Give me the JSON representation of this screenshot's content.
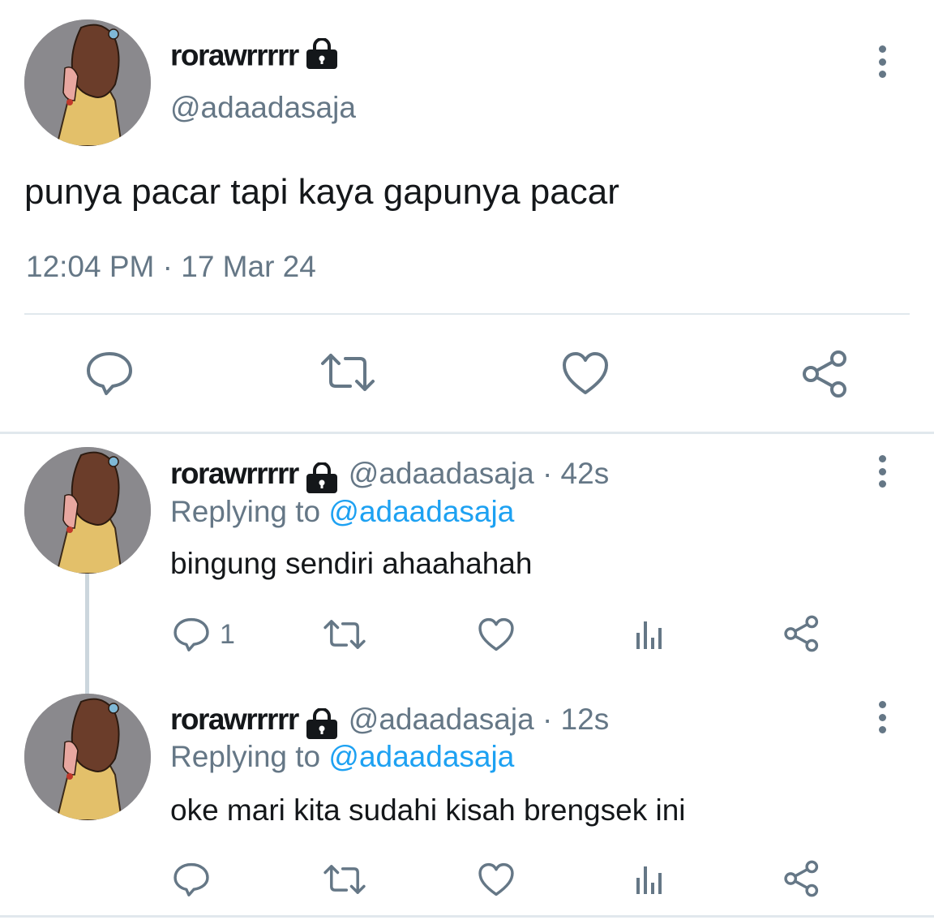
{
  "main_tweet": {
    "display_name": "rorawrrrrr",
    "handle": "@adaadasaja",
    "text": "punya pacar tapi kaya gapunya pacar",
    "timestamp": "12:04 PM · 17 Mar 24"
  },
  "replies": [
    {
      "display_name": "rorawrrrrr",
      "handle_time": "@adaadasaja · 42s",
      "replying_prefix": "Replying to",
      "replying_handle": "@adaadasaja",
      "text": "bingung sendiri ahaahahah",
      "reply_count": "1"
    },
    {
      "display_name": "rorawrrrrr",
      "handle_time": "@adaadasaja · 12s",
      "replying_prefix": "Replying to",
      "replying_handle": "@adaadasaja",
      "text": "oke mari kita sudahi kisah brengsek ini",
      "reply_count": ""
    }
  ],
  "icons": {
    "reply": "comment-icon",
    "retweet": "retweet-icon",
    "like": "heart-icon",
    "analytics": "analytics-icon",
    "share": "share-icon",
    "lock": "lock-icon",
    "more": "more-vertical-icon"
  },
  "colors": {
    "text": "#14171a",
    "secondary": "#657786",
    "link": "#1da1f2",
    "divider": "#e1e8ed",
    "icon": "#657786"
  }
}
